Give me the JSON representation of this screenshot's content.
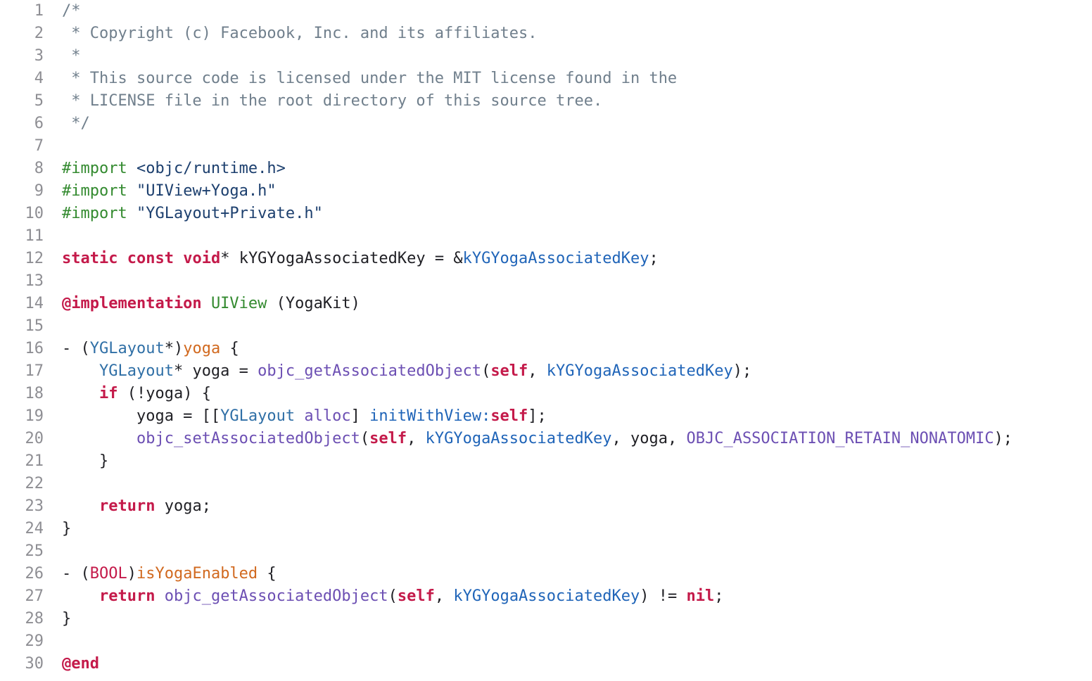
{
  "editor": {
    "colors": {
      "background": "#ffffff",
      "line_number": "#8e8e93",
      "comment": "#707f8c",
      "keyword": "#c41a4a",
      "preprocessor": "#338a2f",
      "string": "#1c3f6e",
      "type": "#2f6fa6",
      "method_name": "#d1691f",
      "function": "#6c4fb3",
      "identifier": "#1f64b8",
      "plain": "#1f1f24"
    },
    "lines": [
      {
        "n": "1",
        "tokens": [
          {
            "t": "/*",
            "c": "comment"
          }
        ]
      },
      {
        "n": "2",
        "tokens": [
          {
            "t": " * Copyright (c) Facebook, Inc. and its affiliates.",
            "c": "comment"
          }
        ]
      },
      {
        "n": "3",
        "tokens": [
          {
            "t": " *",
            "c": "comment"
          }
        ]
      },
      {
        "n": "4",
        "tokens": [
          {
            "t": " * This source code is licensed under the MIT license found in the",
            "c": "comment"
          }
        ]
      },
      {
        "n": "5",
        "tokens": [
          {
            "t": " * LICENSE file in the root directory of this source tree.",
            "c": "comment"
          }
        ]
      },
      {
        "n": "6",
        "tokens": [
          {
            "t": " */",
            "c": "comment"
          }
        ]
      },
      {
        "n": "7",
        "tokens": []
      },
      {
        "n": "8",
        "tokens": [
          {
            "t": "#import ",
            "c": "preproc"
          },
          {
            "t": "<objc/runtime.h>",
            "c": "string"
          }
        ]
      },
      {
        "n": "9",
        "tokens": [
          {
            "t": "#import ",
            "c": "preproc"
          },
          {
            "t": "\"UIView+Yoga.h\"",
            "c": "string"
          }
        ]
      },
      {
        "n": "10",
        "tokens": [
          {
            "t": "#import ",
            "c": "preproc"
          },
          {
            "t": "\"YGLayout+Private.h\"",
            "c": "string"
          }
        ]
      },
      {
        "n": "11",
        "tokens": []
      },
      {
        "n": "12",
        "tokens": [
          {
            "t": "static",
            "c": "keyword"
          },
          {
            "t": " ",
            "c": "plain"
          },
          {
            "t": "const",
            "c": "keyword"
          },
          {
            "t": " ",
            "c": "plain"
          },
          {
            "t": "void",
            "c": "keyword"
          },
          {
            "t": "* kYGYogaAssociatedKey = &",
            "c": "plain"
          },
          {
            "t": "kYGYogaAssociatedKey",
            "c": "ident"
          },
          {
            "t": ";",
            "c": "plain"
          }
        ]
      },
      {
        "n": "13",
        "tokens": []
      },
      {
        "n": "14",
        "tokens": [
          {
            "t": "@implementation",
            "c": "keyword"
          },
          {
            "t": " ",
            "c": "plain"
          },
          {
            "t": "UIView",
            "c": "classdecl"
          },
          {
            "t": " (YogaKit)",
            "c": "plain"
          }
        ]
      },
      {
        "n": "15",
        "tokens": []
      },
      {
        "n": "16",
        "tokens": [
          {
            "t": "- (",
            "c": "plain"
          },
          {
            "t": "YGLayout",
            "c": "type"
          },
          {
            "t": "*)",
            "c": "plain"
          },
          {
            "t": "yoga",
            "c": "method"
          },
          {
            "t": " {",
            "c": "plain"
          }
        ]
      },
      {
        "n": "17",
        "tokens": [
          {
            "t": "    ",
            "c": "plain"
          },
          {
            "t": "YGLayout",
            "c": "type"
          },
          {
            "t": "* yoga = ",
            "c": "plain"
          },
          {
            "t": "objc_getAssociatedObject",
            "c": "func"
          },
          {
            "t": "(",
            "c": "plain"
          },
          {
            "t": "self",
            "c": "keyword"
          },
          {
            "t": ", ",
            "c": "plain"
          },
          {
            "t": "kYGYogaAssociatedKey",
            "c": "ident"
          },
          {
            "t": ");",
            "c": "plain"
          }
        ]
      },
      {
        "n": "18",
        "tokens": [
          {
            "t": "    ",
            "c": "plain"
          },
          {
            "t": "if",
            "c": "keyword"
          },
          {
            "t": " (!yoga) {",
            "c": "plain"
          }
        ]
      },
      {
        "n": "19",
        "tokens": [
          {
            "t": "        yoga = [[",
            "c": "plain"
          },
          {
            "t": "YGLayout",
            "c": "type"
          },
          {
            "t": " ",
            "c": "plain"
          },
          {
            "t": "alloc",
            "c": "func"
          },
          {
            "t": "] ",
            "c": "plain"
          },
          {
            "t": "initWithView:",
            "c": "ident"
          },
          {
            "t": "self",
            "c": "keyword"
          },
          {
            "t": "];",
            "c": "plain"
          }
        ]
      },
      {
        "n": "20",
        "tokens": [
          {
            "t": "        ",
            "c": "plain"
          },
          {
            "t": "objc_setAssociatedObject",
            "c": "func"
          },
          {
            "t": "(",
            "c": "plain"
          },
          {
            "t": "self",
            "c": "keyword"
          },
          {
            "t": ", ",
            "c": "plain"
          },
          {
            "t": "kYGYogaAssociatedKey",
            "c": "ident"
          },
          {
            "t": ", yoga, ",
            "c": "plain"
          },
          {
            "t": "OBJC_ASSOCIATION_RETAIN_NONATOMIC",
            "c": "func"
          },
          {
            "t": ");",
            "c": "plain"
          }
        ]
      },
      {
        "n": "21",
        "tokens": [
          {
            "t": "    }",
            "c": "plain"
          }
        ]
      },
      {
        "n": "22",
        "tokens": []
      },
      {
        "n": "23",
        "tokens": [
          {
            "t": "    ",
            "c": "plain"
          },
          {
            "t": "return",
            "c": "keyword"
          },
          {
            "t": " yoga;",
            "c": "plain"
          }
        ]
      },
      {
        "n": "24",
        "tokens": [
          {
            "t": "}",
            "c": "plain"
          }
        ]
      },
      {
        "n": "25",
        "tokens": []
      },
      {
        "n": "26",
        "tokens": [
          {
            "t": "- (",
            "c": "plain"
          },
          {
            "t": "BOOL",
            "c": "keyword_light"
          },
          {
            "t": ")",
            "c": "plain"
          },
          {
            "t": "isYogaEnabled",
            "c": "method"
          },
          {
            "t": " {",
            "c": "plain"
          }
        ]
      },
      {
        "n": "27",
        "tokens": [
          {
            "t": "    ",
            "c": "plain"
          },
          {
            "t": "return",
            "c": "keyword"
          },
          {
            "t": " ",
            "c": "plain"
          },
          {
            "t": "objc_getAssociatedObject",
            "c": "func"
          },
          {
            "t": "(",
            "c": "plain"
          },
          {
            "t": "self",
            "c": "keyword"
          },
          {
            "t": ", ",
            "c": "plain"
          },
          {
            "t": "kYGYogaAssociatedKey",
            "c": "ident"
          },
          {
            "t": ") != ",
            "c": "plain"
          },
          {
            "t": "nil",
            "c": "keyword"
          },
          {
            "t": ";",
            "c": "plain"
          }
        ]
      },
      {
        "n": "28",
        "tokens": [
          {
            "t": "}",
            "c": "plain"
          }
        ]
      },
      {
        "n": "29",
        "tokens": []
      },
      {
        "n": "30",
        "tokens": [
          {
            "t": "@end",
            "c": "keyword"
          }
        ]
      }
    ]
  }
}
